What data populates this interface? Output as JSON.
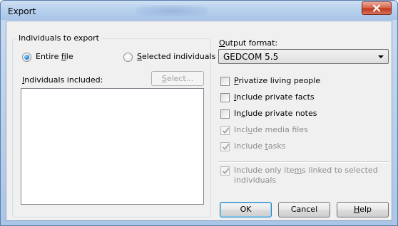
{
  "window": {
    "title": "Export",
    "close_icon": "close-icon",
    "accent_color": "#c7463b"
  },
  "individuals_group": {
    "label": "Individuals to export",
    "entire_file": {
      "pre": "Entire ",
      "key": "f",
      "post": "ile",
      "selected": true
    },
    "selected_individuals": {
      "pre": "",
      "key": "S",
      "post": "elected individuals",
      "selected": false
    },
    "included_label": {
      "pre": "",
      "key": "I",
      "post": "ndividuals included:"
    },
    "select_button": {
      "pre": "",
      "key": "S",
      "post": "elect...",
      "enabled": false
    },
    "included_list": []
  },
  "output": {
    "label": {
      "pre": "",
      "key": "O",
      "post": "utput format:"
    },
    "format_value": "GEDCOM 5.5"
  },
  "options": [
    {
      "pre": "",
      "key": "P",
      "post": "rivatize living people",
      "checked": false,
      "enabled": true
    },
    {
      "pre": "",
      "key": "I",
      "post": "nclude private facts",
      "checked": false,
      "enabled": true
    },
    {
      "pre": "In",
      "key": "c",
      "post": "lude private notes",
      "checked": false,
      "enabled": true
    },
    {
      "pre": "Incl",
      "key": "u",
      "post": "de media files",
      "checked": true,
      "enabled": false
    },
    {
      "pre": "Include ",
      "key": "t",
      "post": "asks",
      "checked": true,
      "enabled": false
    }
  ],
  "linked_option": {
    "line1_pre": "Include only ite",
    "key": "m",
    "line1_post": "s linked  to selected",
    "line2": "individuals",
    "checked": true,
    "enabled": false
  },
  "buttons": {
    "ok": "OK",
    "cancel": "Cancel",
    "help": {
      "pre": "",
      "key": "H",
      "post": "elp"
    }
  }
}
